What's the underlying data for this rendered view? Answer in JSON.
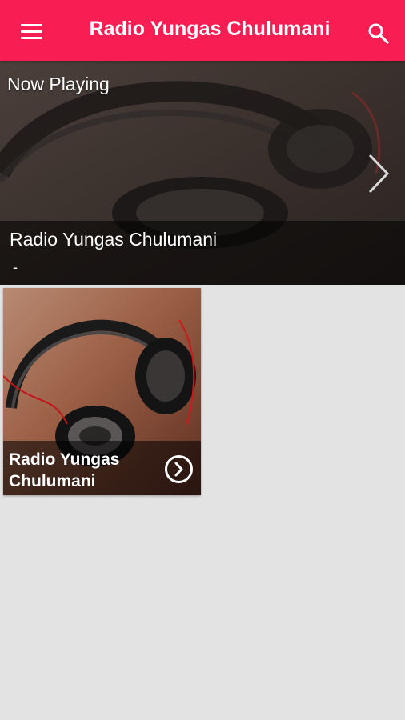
{
  "appbar": {
    "title": "Radio Yungas Chulumani",
    "menu_icon": "menu-icon",
    "search_icon": "search-icon",
    "color": "#f81e54"
  },
  "now_playing": {
    "heading": "Now Playing",
    "station": "Radio Yungas Chulumani",
    "subtitle": "-",
    "next_icon": "chevron-right-icon"
  },
  "stations": [
    {
      "name": "Radio Yungas Chulumani",
      "image": "headphones-image",
      "action_icon": "play-circle-icon"
    }
  ]
}
